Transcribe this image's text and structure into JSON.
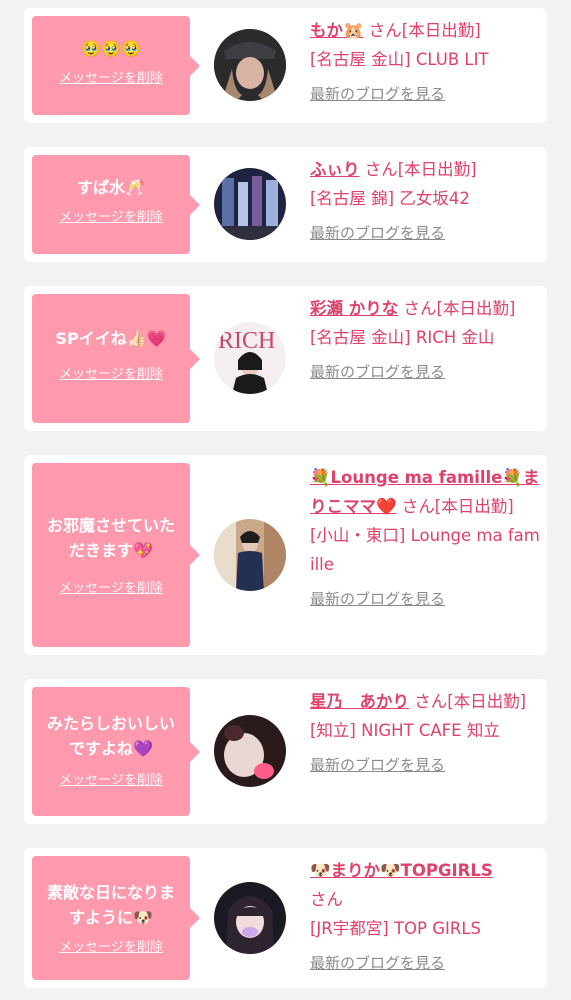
{
  "cards": [
    {
      "message": "🥹🥹🥹",
      "delete_label": "メッセージを削除",
      "name": "もか🐹",
      "san": " さん",
      "status": "[本日出勤]",
      "shop": "[名古屋 金山] CLUB LIT",
      "blog_label": "最新のブログを見る"
    },
    {
      "message": "すぱ水🥂",
      "delete_label": "メッセージを削除",
      "name": "ふぃり",
      "san": " さん",
      "status": "[本日出勤]",
      "shop": "[名古屋 錦] 乙女坂42",
      "blog_label": "最新のブログを見る"
    },
    {
      "message": "SPイイね👍🏻💗",
      "delete_label": "メッセージを削除",
      "name": "彩瀬 かりな",
      "san": " さん",
      "status": "[本日出勤]",
      "shop": "[名古屋 金山] RICH 金山",
      "blog_label": "最新のブログを見る"
    },
    {
      "message": "お邪魔させていただきます💖",
      "delete_label": "メッセージを削除",
      "name": "💐Lounge ma famille💐まりこママ❤️",
      "san": " さん",
      "status": "[本日出勤]",
      "shop": "[小山・東口] Lounge ma famille",
      "blog_label": "最新のブログを見る"
    },
    {
      "message": "みたらしおいしいですよね💜",
      "delete_label": "メッセージを削除",
      "name": "星乃　あかり",
      "san": " さん",
      "status": "[本日出勤]",
      "shop": "[知立] NIGHT CAFE 知立",
      "blog_label": "最新のブログを見る"
    },
    {
      "message": "素敵な日になりますように🐶",
      "delete_label": "メッセージを削除",
      "name": "🐶まりか🐶TOPGIRLS",
      "san": " さん",
      "status": "",
      "shop": "[JR宇都宮] TOP GIRLS",
      "blog_label": "最新のブログを見る"
    }
  ],
  "colors": {
    "accent": "#e0416a",
    "bubble": "#ff99ad",
    "background": "#f2f2f2",
    "card": "#ffffff",
    "muted": "#8a8a8a"
  }
}
